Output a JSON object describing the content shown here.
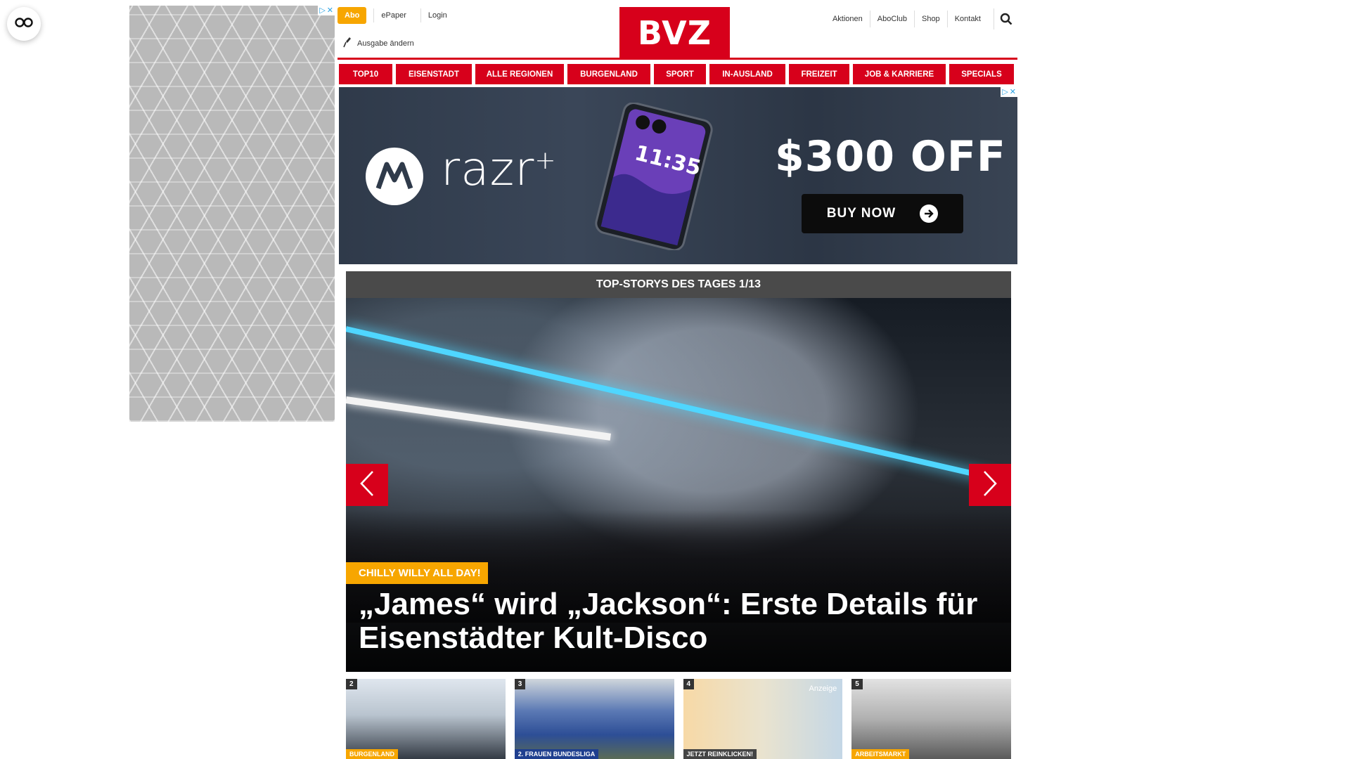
{
  "header": {
    "abo": "Abo",
    "epaper": "ePaper",
    "login": "Login",
    "edition": "Ausgabe ändern",
    "logo": "BVZ",
    "links": [
      "Aktionen",
      "AboClub",
      "Shop",
      "Kontakt"
    ]
  },
  "nav": [
    {
      "label": "TOP10",
      "w": 76
    },
    {
      "label": "EISENSTADT",
      "w": 108
    },
    {
      "label": "ALLE REGIONEN",
      "w": 126
    },
    {
      "label": "BURGENLAND",
      "w": 118
    },
    {
      "label": "SPORT",
      "w": 74
    },
    {
      "label": "IN-AUSLAND",
      "w": 108
    },
    {
      "label": "FREIZEIT",
      "w": 86
    },
    {
      "label": "JOB & KARRIERE",
      "w": 132
    },
    {
      "label": "SPECIALS",
      "w": 92
    }
  ],
  "banner": {
    "brand": "razr",
    "brand_sup": "+",
    "phone_time": "11:35",
    "offer": "$300 OFF",
    "cta": "BUY NOW"
  },
  "stories": {
    "heading": "TOP-STORYS DES TAGES 1/13",
    "kicker": "CHILLY WILLY ALL DAY!",
    "headline": "„James“ wird „Jackson“: Erste Details für Eisenstädter Kult-Disco"
  },
  "thumbs": [
    {
      "num": "2",
      "tag": "BURGENLAND",
      "tag_color": "#f7a600"
    },
    {
      "num": "3",
      "tag": "2. FRAUEN BUNDESLIGA",
      "tag_color": "#1f3f8f"
    },
    {
      "num": "4",
      "tag": "JETZT REINKLICKEN!",
      "tag_color": "#444444",
      "badge": "Anzeige"
    },
    {
      "num": "5",
      "tag": "ARBEITSMARKT",
      "tag_color": "#f7a600"
    }
  ],
  "colors": {
    "brand_red": "#d7001b",
    "accent_orange": "#f7a600"
  }
}
